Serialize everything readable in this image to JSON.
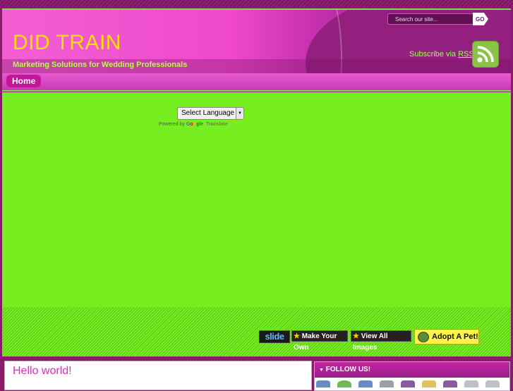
{
  "header": {
    "title": "DID TRAIN",
    "tagline": "Marketing Solutions for Wedding Professionals",
    "search": {
      "placeholder": "Search our site...",
      "go_label": "GO"
    },
    "subscribe_text": "Subscribe via",
    "rss_link": "RSS"
  },
  "nav": {
    "items": [
      {
        "label": "Home"
      }
    ]
  },
  "translate": {
    "select_label": "Select Language",
    "powered_by": "Powered by",
    "google": [
      "G",
      "o",
      "o",
      "gle"
    ],
    "translate_word": "Translate"
  },
  "slideshow": {
    "logo": "slide",
    "make_own": "Make Your Own",
    "view_all": "View All Images",
    "adopt": "Adopt A Pet!"
  },
  "post": {
    "title": "Hello world!"
  },
  "sidebar": {
    "follow_title": "FOLLOW US!",
    "icons": [
      "blue-icon",
      "green-icon",
      "blue-icon",
      "grey-icon",
      "purple-icon",
      "yellow-icon",
      "purple-icon",
      "grey-icon",
      "grey-icon"
    ]
  },
  "colors": {
    "accent_pink": "#ef48cc",
    "accent_green": "#77ee1f",
    "title_yellow": "#ffe100",
    "tagline_green": "#b8ff3f",
    "deep_purple": "#8a1a6c"
  }
}
